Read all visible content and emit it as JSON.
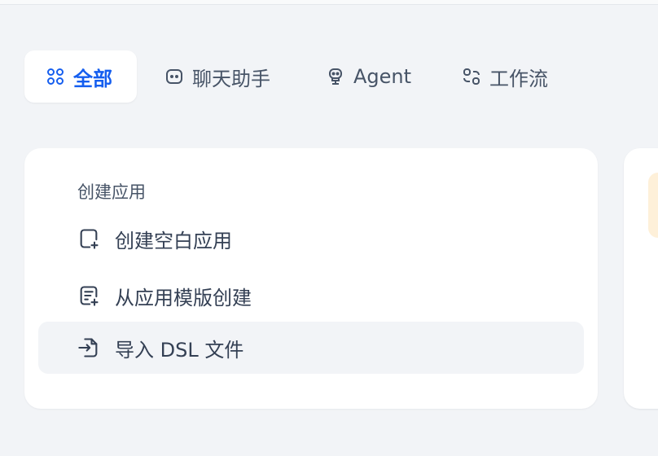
{
  "tabs": [
    {
      "label": "全部",
      "icon": "grid-icon",
      "active": true
    },
    {
      "label": "聊天助手",
      "icon": "chat-bubble-icon",
      "active": false
    },
    {
      "label": "Agent",
      "icon": "robot-icon",
      "active": false
    },
    {
      "label": "工作流",
      "icon": "workflow-icon",
      "active": false
    }
  ],
  "create_card": {
    "title": "创建应用",
    "items": [
      {
        "label": "创建空白应用",
        "icon": "file-plus-icon"
      },
      {
        "label": "从应用模版创建",
        "icon": "template-file-icon"
      },
      {
        "label": "导入 DSL 文件",
        "icon": "import-file-icon"
      }
    ]
  },
  "colors": {
    "accent": "#155eef",
    "text": "#344054",
    "muted": "#475467",
    "background": "#f2f4f7",
    "card": "#ffffff",
    "badge": "#fef0d9"
  }
}
